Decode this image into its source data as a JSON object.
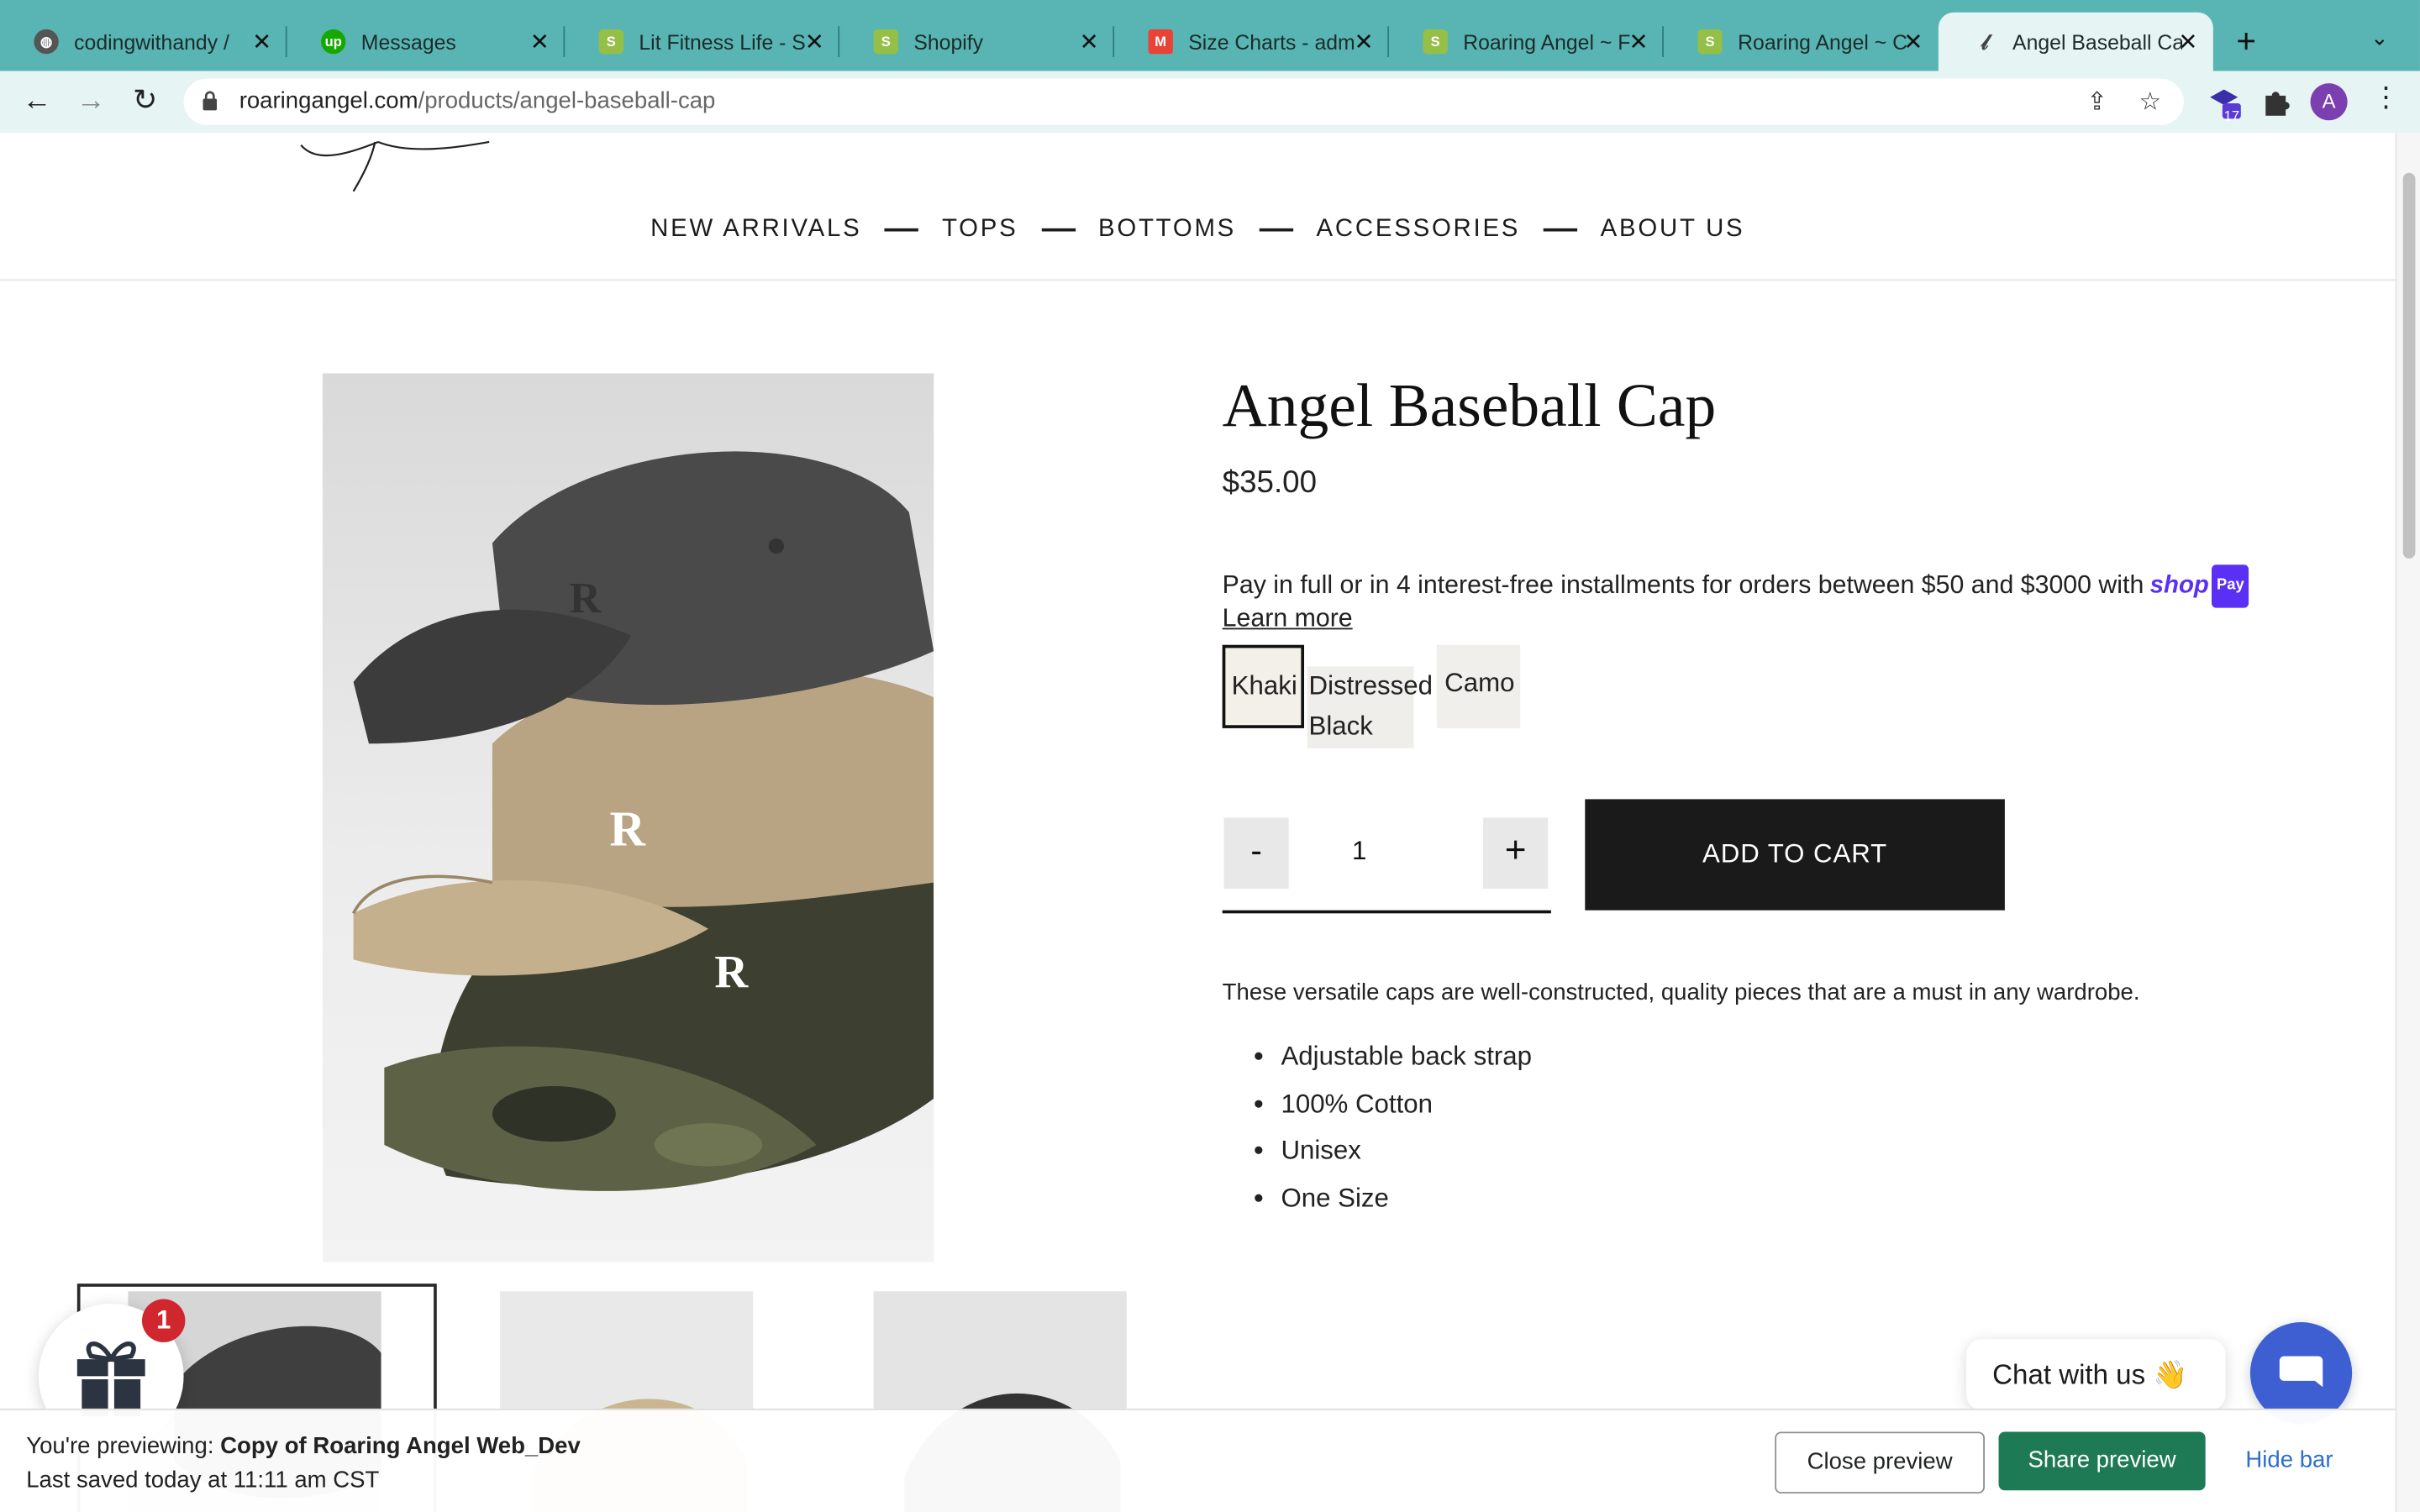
{
  "browser": {
    "tabs": [
      {
        "title": "codingwithandy / ",
        "active": false
      },
      {
        "title": "Messages",
        "active": false
      },
      {
        "title": "Lit Fitness Life - S",
        "active": false
      },
      {
        "title": "Shopify",
        "active": false
      },
      {
        "title": "Size Charts - adm",
        "active": false
      },
      {
        "title": "Roaring Angel ~ F",
        "active": false
      },
      {
        "title": "Roaring Angel ~ C",
        "active": false
      },
      {
        "title": "Angel Baseball Ca",
        "active": true
      }
    ],
    "url_domain": "roaringangel.com",
    "url_path": "/products/angel-baseball-cap",
    "extension_badge": "17",
    "profile_initial": "A",
    "accent_color": "#58b5b4"
  },
  "store": {
    "nav": [
      "NEW ARRIVALS",
      "TOPS",
      "BOTTOMS",
      "ACCESSORIES",
      "ABOUT US"
    ]
  },
  "product": {
    "title": "Angel Baseball Cap",
    "price": "$35.00",
    "installments_text": "Pay in full or in 4 interest-free installments for orders between $50 and $3000 with",
    "shoppay_word": "shop",
    "shoppay_pill": "Pay",
    "learn_more": "Learn more",
    "variants": {
      "khaki": "Khaki",
      "distressed_black": "Distressed Black",
      "camo": "Camo",
      "selected": "Khaki"
    },
    "quantity": "1",
    "minus_label": "-",
    "plus_label": "+",
    "add_to_cart": "ADD TO CART",
    "description": "These versatile caps are well-constructed, quality pieces that are a must in any wardrobe.",
    "features": [
      "Adjustable back strap",
      "100% Cotton",
      "Unisex",
      "One Size"
    ]
  },
  "widgets": {
    "gift_badge": "1",
    "chat_label": "Chat with us 👋"
  },
  "preview_bar": {
    "line1_prefix": "You're previewing: ",
    "theme_name": "Copy of Roaring Angel Web_Dev",
    "line2": "Last saved today at 11:11 am CST",
    "close_label": "Close preview",
    "share_label": "Share preview",
    "hide_label": "Hide bar"
  }
}
